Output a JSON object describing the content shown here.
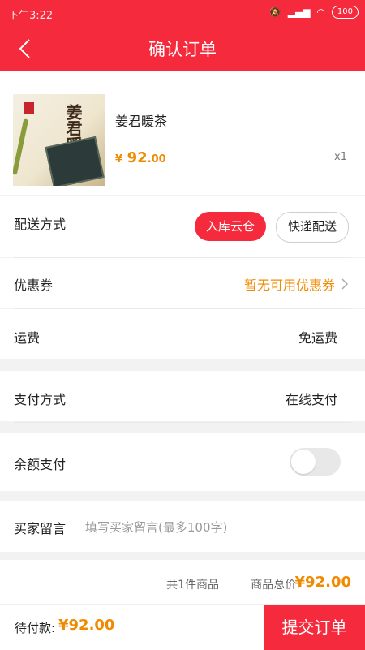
{
  "statusbar": {
    "time": "下午3:22",
    "battery": "100"
  },
  "header": {
    "title": "确认订单"
  },
  "product": {
    "name": "姜君暖茶",
    "price_symbol": "¥",
    "price_int": "92",
    "price_dec": ".00",
    "quantity": "x1",
    "thumb_text": "姜君暖茶"
  },
  "delivery": {
    "label": "配送方式",
    "options": [
      "入库云仓",
      "快递配送"
    ],
    "selected": "入库云仓"
  },
  "coupon": {
    "label": "优惠券",
    "value": "暂无可用优惠券"
  },
  "shipping": {
    "label": "运费",
    "value": "免运费"
  },
  "payment": {
    "label": "支付方式",
    "value": "在线支付"
  },
  "balance": {
    "label": "余额支付",
    "enabled": false
  },
  "note": {
    "label": "买家留言",
    "placeholder": "填写买家留言(最多100字)",
    "value": ""
  },
  "summary": {
    "count_text": "共1件商品",
    "total_label": "商品总价:",
    "total": "¥92.00"
  },
  "footer": {
    "due_label": "待付款:",
    "due": "¥92.00",
    "submit_label": "提交订单"
  },
  "colors": {
    "accent": "#f52a3c",
    "price": "#f08a00"
  }
}
